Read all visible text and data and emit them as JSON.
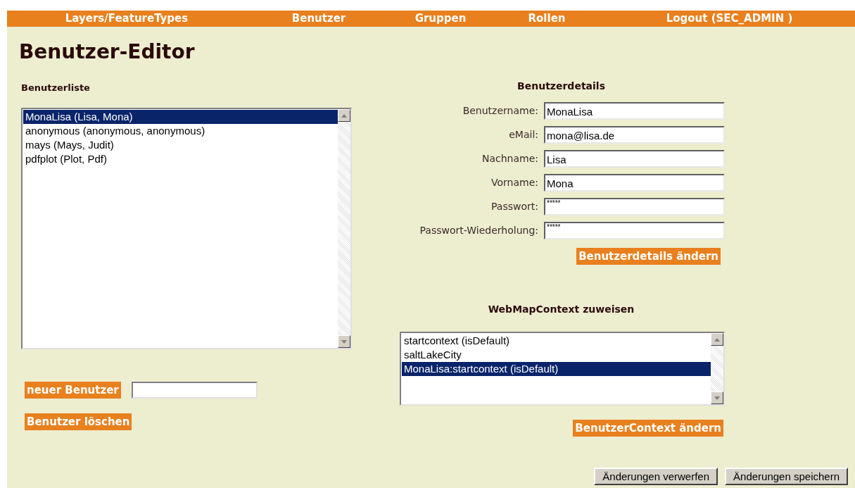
{
  "nav": [
    {
      "label": "Layers/FeatureTypes"
    },
    {
      "label": "Benutzer"
    },
    {
      "label": "Gruppen"
    },
    {
      "label": "Rollen"
    },
    {
      "label": "Logout (SEC_ADMIN )"
    }
  ],
  "title": "Benutzer-Editor",
  "user_list": {
    "heading": "Benutzerliste",
    "items": [
      {
        "label": "MonaLisa (Lisa, Mona)",
        "selected": true
      },
      {
        "label": "anonymous (anonymous, anonymous)",
        "selected": false
      },
      {
        "label": "mays (Mays, Judit)",
        "selected": false
      },
      {
        "label": "pdfplot (Plot, Pdf)",
        "selected": false
      }
    ]
  },
  "new_user_button": "neuer Benutzer",
  "delete_user_button": "Benutzer löschen",
  "details": {
    "heading": "Benutzerdetails",
    "fields": [
      {
        "label": "Benutzername:",
        "value": "MonaLisa",
        "kind": "text"
      },
      {
        "label": "eMail:",
        "value": "mona@lisa.de",
        "kind": "text"
      },
      {
        "label": "Nachname:",
        "value": "Lisa",
        "kind": "text"
      },
      {
        "label": "Vorname:",
        "value": "Mona",
        "kind": "text"
      },
      {
        "label": "Passwort:",
        "value": "*****",
        "kind": "password"
      },
      {
        "label": "Passwort-Wiederholung:",
        "value": "*****",
        "kind": "password"
      }
    ],
    "button": "Benutzerdetails ändern"
  },
  "context": {
    "heading": "WebMapContext zuweisen",
    "items": [
      {
        "label": "startcontext (isDefault)",
        "selected": false
      },
      {
        "label": "saltLakeCity",
        "selected": false
      },
      {
        "label": "MonaLisa:startcontext (isDefault)",
        "selected": true
      }
    ],
    "button": "BenutzerContext ändern"
  },
  "footer_buttons": [
    "Änderungen verwerfen",
    "Änderungen speichern"
  ]
}
